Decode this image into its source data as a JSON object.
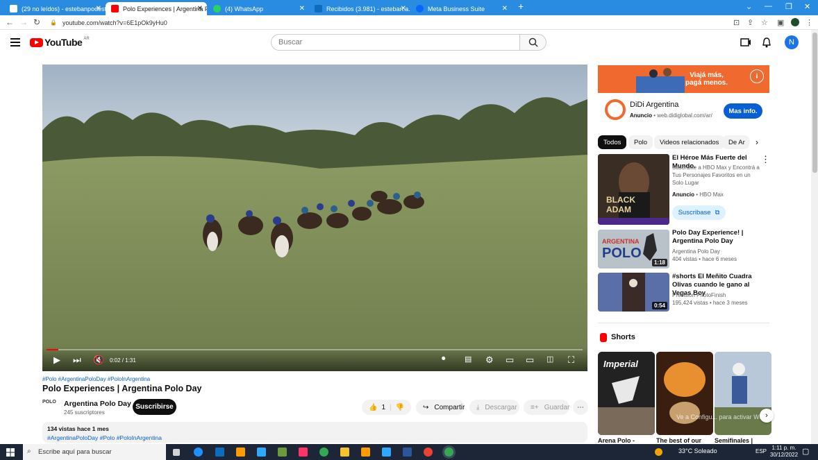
{
  "browser": {
    "tabs": [
      {
        "title": "(29 no leídos) - estebanpodesta"
      },
      {
        "title": "Polo Experiences | Argentina Polo"
      },
      {
        "title": "(4) WhatsApp"
      },
      {
        "title": "Recibidos (3.981) - esteban.a.po"
      },
      {
        "title": "Meta Business Suite"
      }
    ],
    "url": "youtube.com/watch?v=6E1pOk9yHu0"
  },
  "header": {
    "logo_text": "YouTube",
    "logo_region": "AR",
    "search_placeholder": "Buscar",
    "avatar_letter": "N"
  },
  "player": {
    "time": "0:02 / 1:31",
    "progress": 0.022
  },
  "video": {
    "hashtags": "#Polo #ArgentinaPoloDay #PoloInArgentina",
    "title": "Polo Experiences | Argentina Polo Day",
    "channel_name": "Argentina Polo Day",
    "channel_logo_text": "POLO",
    "subscribers": "245 suscriptores",
    "subscribe_label": "Suscribirse",
    "likes": "1",
    "share_label": "Compartir",
    "download_label": "Descargar",
    "save_label": "Guardar",
    "views_date": "134 vistas  hace 1 mes",
    "desc_hashtags": "#ArgentinaPoloDay #Polo #PoloInArgentina"
  },
  "ad": {
    "banner_line1": "Viajá más,",
    "banner_line2": "pagá menos.",
    "advertiser": "DiDi Argentina",
    "label": "Anuncio",
    "domain": "web.didiglobal.com/ar/",
    "cta": "Mas info."
  },
  "chips": [
    "Todos",
    "Polo",
    "Videos relacionados",
    "De Ar"
  ],
  "related": [
    {
      "title": "El Héroe Más Fuerte del Mundo.",
      "desc": "Suscribite a HBO Max y Encontrá a Tus Personajes Favoritos en un Solo Lugar",
      "meta_label": "Anuncio",
      "meta": "HBO Max",
      "cta": "Suscribase"
    },
    {
      "title": "Polo Day Experience! | Argentina Polo Day",
      "channel": "Argentina Polo Day",
      "stats": "404 vistas  • hace 6 meses",
      "duration": "1:18"
    },
    {
      "title": "#shorts El Meñito Cuadra Olivas cuando le gano al Vegas Boy",
      "channel": "Precision PhotoFinish",
      "stats": "195,424 vistas  • hace 3 meses",
      "duration": "0:54"
    }
  ],
  "shorts": {
    "title": "Shorts",
    "items": [
      {
        "title": "Arena Polo -"
      },
      {
        "title": "The best of our"
      },
      {
        "title": "Semifinales |"
      }
    ],
    "watermark": "Ve a Configu... para activar Windows."
  },
  "taskbar": {
    "search_placeholder": "Escribe aquí para buscar",
    "weather": "33°C  Soleado",
    "lang": "ESP",
    "time": "1:11 p. m.",
    "date": "30/12/2022"
  }
}
